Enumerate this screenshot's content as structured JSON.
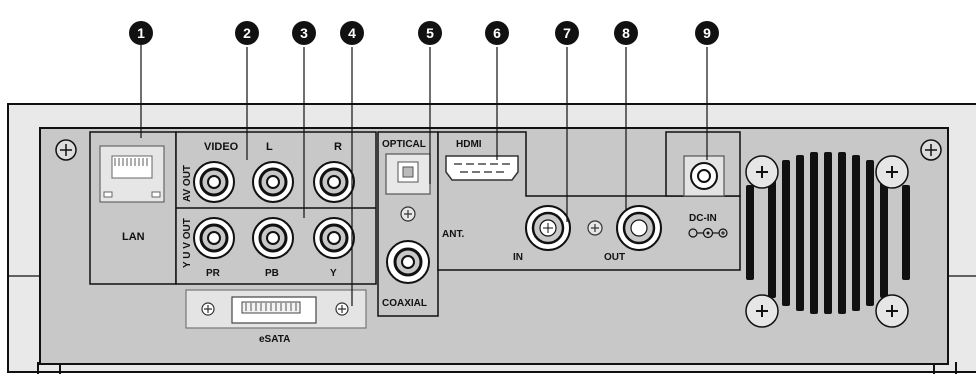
{
  "callouts": [
    "1",
    "2",
    "3",
    "4",
    "5",
    "6",
    "7",
    "8",
    "9"
  ],
  "labels": {
    "lan": "LAN",
    "video": "VIDEO",
    "audio_l": "L",
    "audio_r": "R",
    "av_out": "AV OUT",
    "yuv_out": "Y U V OUT",
    "pr": "PR",
    "pb": "PB",
    "y": "Y",
    "optical": "OPTICAL",
    "coaxial": "COAXIAL",
    "hdmi": "HDMI",
    "ant": "ANT.",
    "ant_in": "IN",
    "ant_out": "OUT",
    "dc_in": "DC-IN",
    "esata": "eSATA"
  },
  "colors": {
    "panel": "#c8c8c8",
    "panel_light": "#e4e4e4",
    "frame": "#e9e9e9",
    "line": "#111111",
    "callout_fill": "#111111"
  }
}
